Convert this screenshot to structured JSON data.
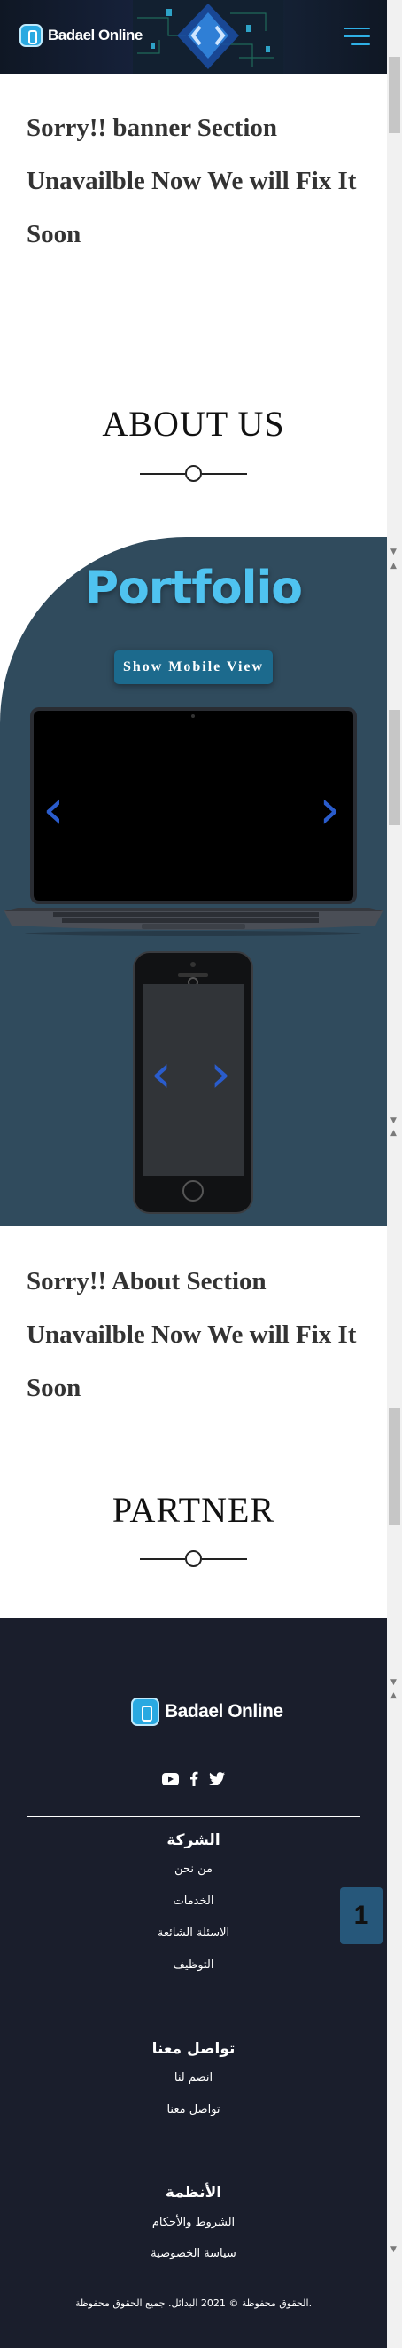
{
  "header": {
    "logo_text": "Badael Online",
    "menu_icon": "hamburger-menu-icon"
  },
  "banner": {
    "message": "Sorry!! banner Section Unavailble Now We will Fix It Soon"
  },
  "about": {
    "title": "ABOUT US",
    "message": "Sorry!! About Section Unavailble Now We will Fix It Soon"
  },
  "portfolio": {
    "title": "Portfolio",
    "button_label": "Show Mobile View",
    "arrow_left": "‹",
    "arrow_right": "›",
    "accent_color": "#4fc3f0"
  },
  "partner": {
    "title": "PARTNER"
  },
  "footer": {
    "logo_text": "Badael Online",
    "social": [
      "youtube-icon",
      "facebook-icon",
      "twitter-icon"
    ],
    "company": {
      "heading": "الشركة",
      "links": [
        "من نحن",
        "الخدمات",
        "الاسئلة الشائعة",
        "التوظيف"
      ]
    },
    "contact": {
      "heading": "تواصل معنا",
      "links": [
        "انضم لنا",
        "تواصل معنا"
      ]
    },
    "systems": {
      "heading": "الأنظمة",
      "links": [
        "الشروط والأحكام",
        "سياسة الخصوصية"
      ]
    },
    "badge_label": "1",
    "copyright": "الحقوق محفوظة © 2021 البدائل. جميع الحقوق محفوظة."
  }
}
